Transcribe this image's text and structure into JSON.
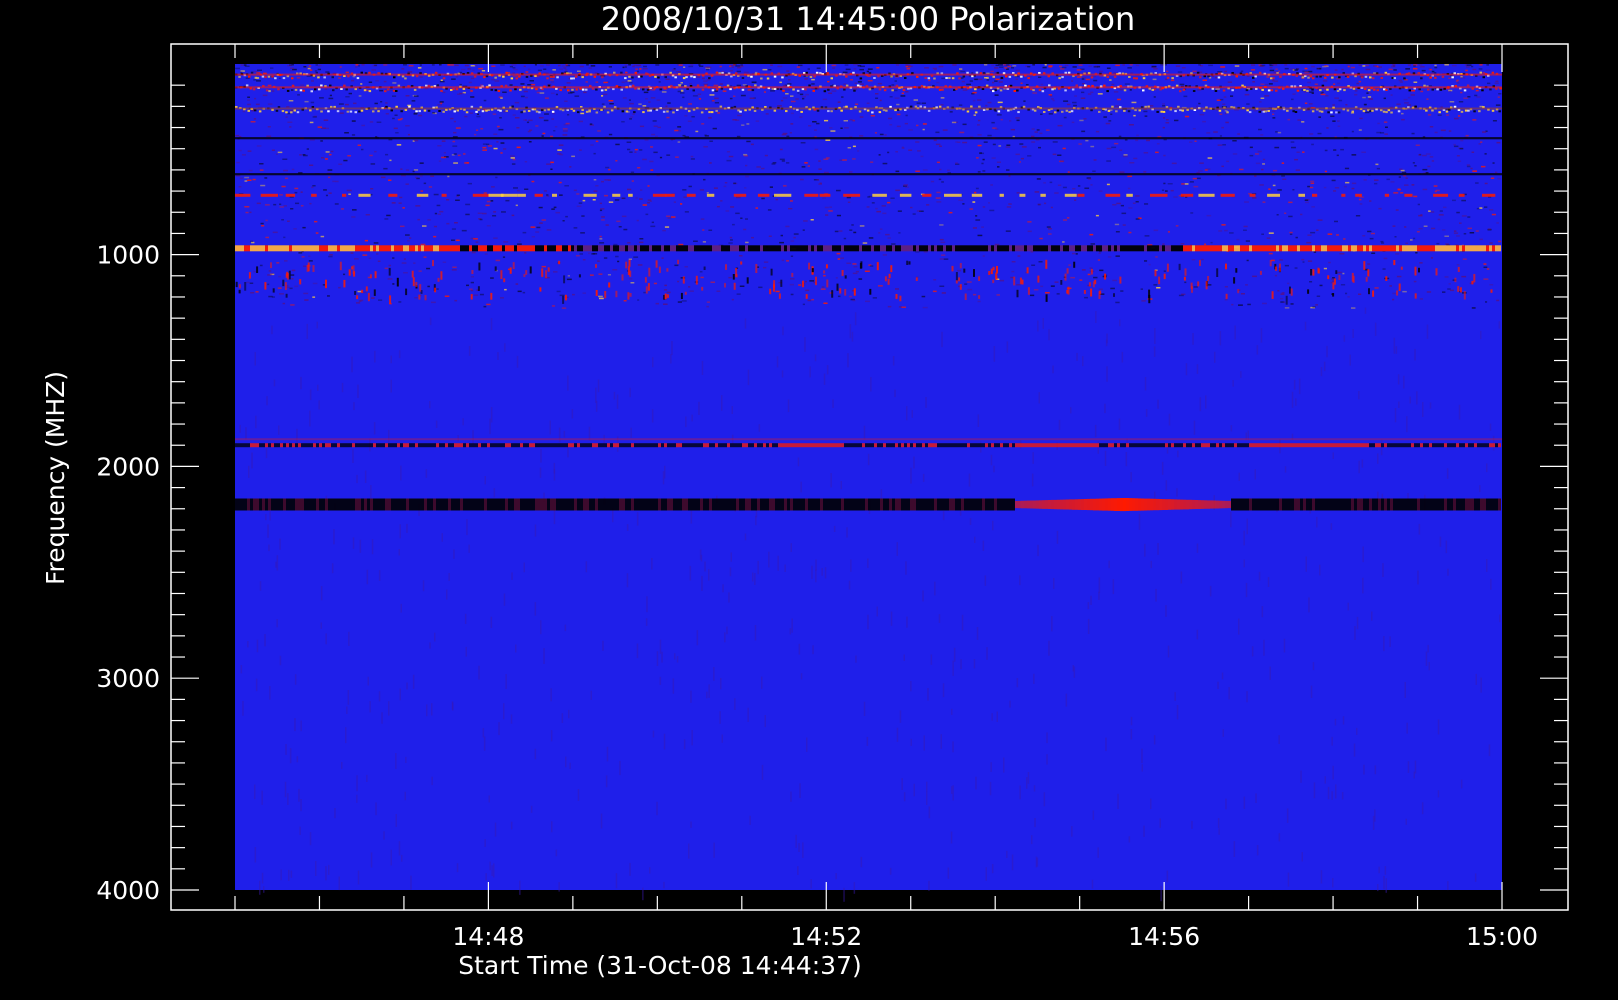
{
  "chart_data": {
    "type": "heatmap",
    "title": "2008/10/31 14:45:00 Polarization",
    "xlabel": "Start Time (31-Oct-08 14:44:37)",
    "ylabel": "Frequency (MHZ)",
    "x_range": [
      "14:45:00",
      "15:00:00"
    ],
    "y_range_mhz": [
      100,
      4000
    ],
    "y_inverted": true,
    "x_ticks": [
      {
        "label": "14:48",
        "minutes_after_1445": 3
      },
      {
        "label": "14:52",
        "minutes_after_1445": 7
      },
      {
        "label": "14:56",
        "minutes_after_1445": 11
      },
      {
        "label": "15:00",
        "minutes_after_1445": 15
      }
    ],
    "y_ticks": [
      {
        "label": "1000",
        "mhz": 1000
      },
      {
        "label": "2000",
        "mhz": 2000
      },
      {
        "label": "3000",
        "mhz": 3000
      },
      {
        "label": "4000",
        "mhz": 4000
      }
    ],
    "colors": {
      "background": "#000000",
      "base": "#1f1fea",
      "low": "#000000",
      "mid": "#ff1a00",
      "high": "#ffd040",
      "axis": "#ffffff"
    },
    "grid": false,
    "legend": "none",
    "bands": [
      {
        "mhz": 150,
        "kind": "speckle-mixed"
      },
      {
        "mhz": 210,
        "kind": "speckle-mixed"
      },
      {
        "mhz": 310,
        "kind": "speckle-yellow"
      },
      {
        "mhz": 450,
        "kind": "dark-line"
      },
      {
        "mhz": 620,
        "kind": "dark-line"
      },
      {
        "mhz": 720,
        "kind": "red-yellow-dashes"
      },
      {
        "mhz": 970,
        "kind": "yellow-red-strong"
      },
      {
        "mhz": 1100,
        "kind": "red-dots"
      },
      {
        "mhz": 1900,
        "kind": "red-dark-line"
      },
      {
        "mhz": 2180,
        "kind": "dark-then-red-burst",
        "burst_start_min": 9,
        "burst_peak_min": 10.5,
        "burst_end_min": 12
      }
    ]
  }
}
